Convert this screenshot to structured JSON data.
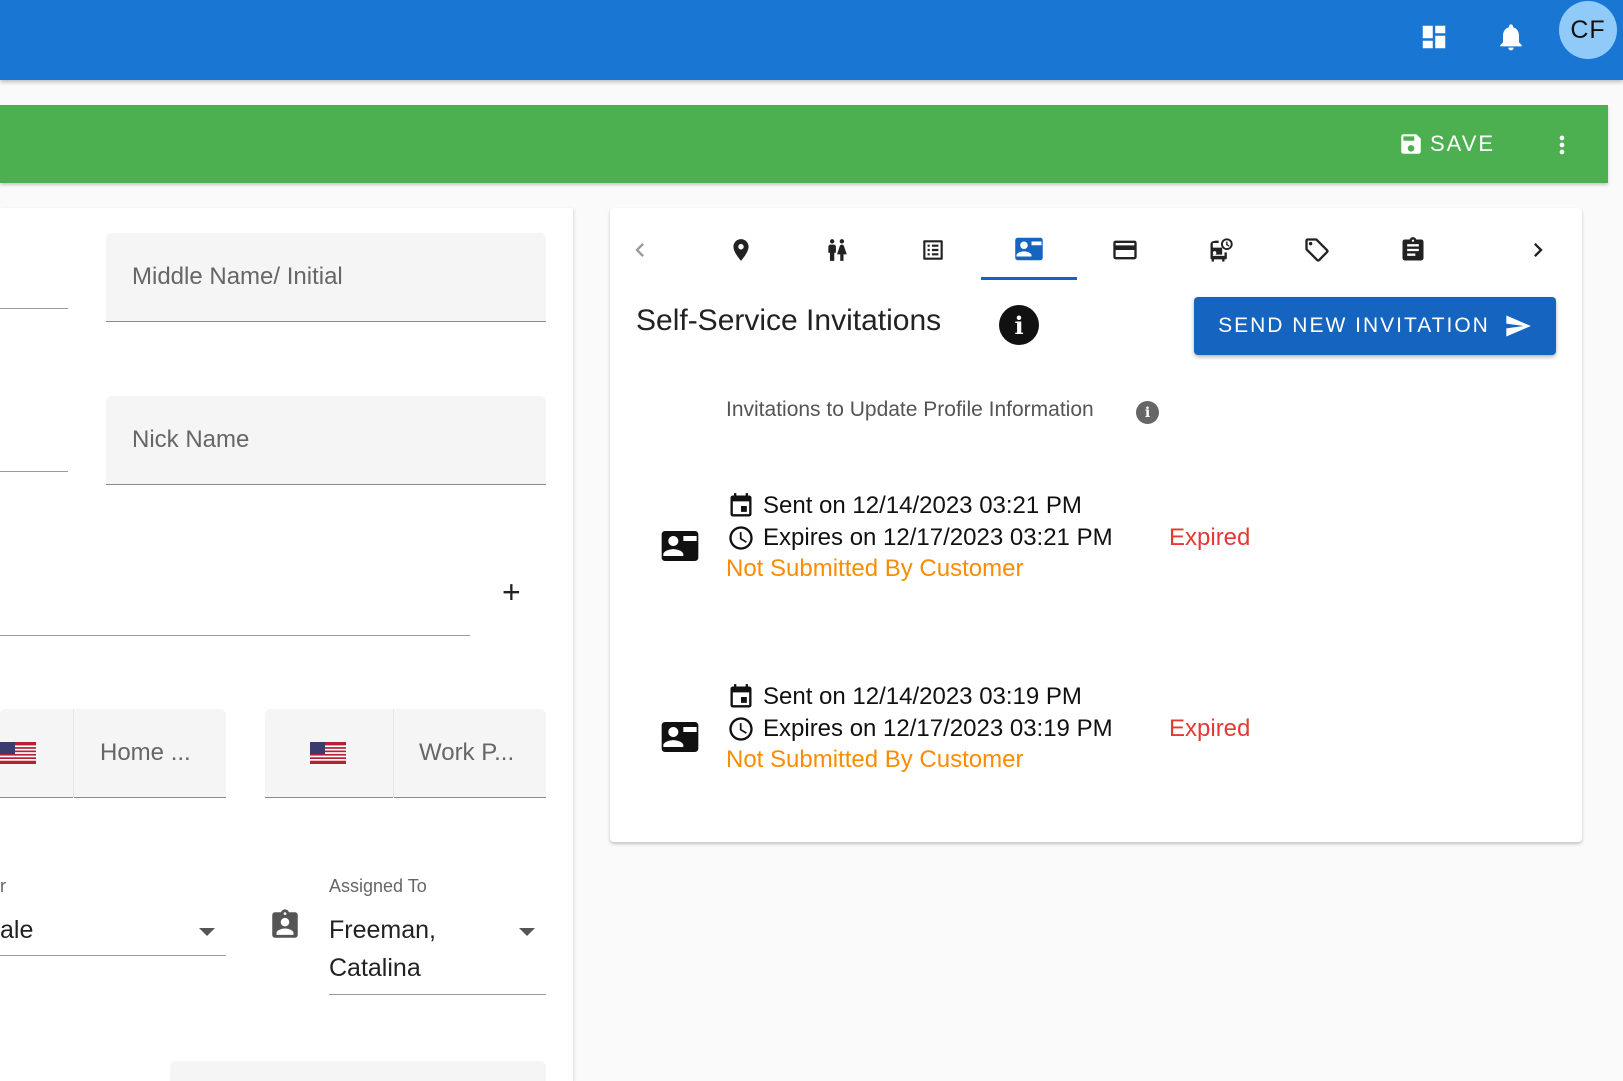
{
  "topbar": {
    "icons": [
      "dashboard-icon",
      "bell-icon"
    ],
    "avatar_initials": "CF",
    "accent": "#1976d2"
  },
  "actionbar": {
    "save_label": "SAVE",
    "accent": "#4caf50"
  },
  "form": {
    "middle_name_placeholder": "Middle Name/ Initial",
    "nick_name_placeholder": "Nick Name",
    "phone_home_label": "Home ...",
    "phone_work_label": "Work P...",
    "left_select_label": "r",
    "left_select_value": "ale",
    "assigned_to_label": "Assigned To",
    "assigned_to_value_line1": "Freeman,",
    "assigned_to_value_line2": "Catalina"
  },
  "tabs": {
    "icons": [
      "map-pin-icon",
      "people-icon",
      "list-icon",
      "contact-card-icon",
      "credit-card-icon",
      "bus-clock-icon",
      "tag-icon",
      "clipboard-icon"
    ],
    "active_index": 3
  },
  "invitations": {
    "title": "Self-Service Invitations",
    "send_button_label": "SEND NEW INVITATION",
    "subtitle": "Invitations to Update Profile Information",
    "items": [
      {
        "sent": "Sent on 12/14/2023 03:21 PM",
        "expires": "Expires on 12/17/2023 03:21 PM",
        "status": "Expired",
        "submission": "Not Submitted By Customer"
      },
      {
        "sent": "Sent on 12/14/2023 03:19 PM",
        "expires": "Expires on 12/17/2023 03:19 PM",
        "status": "Expired",
        "submission": "Not Submitted By Customer"
      }
    ],
    "status_color": "#e53935",
    "submission_color": "#fb8c00"
  }
}
